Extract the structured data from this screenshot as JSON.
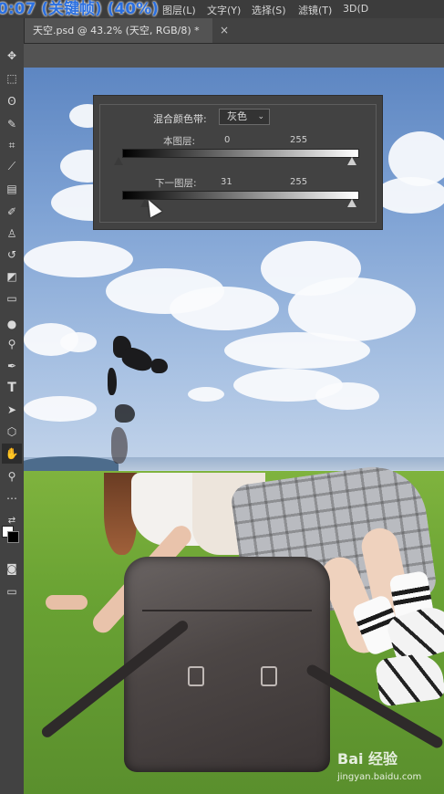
{
  "overlay_status": "0:07 (关键帧) (40%)",
  "menu": {
    "items": [
      "图层(L)",
      "文字(Y)",
      "选择(S)",
      "滤镜(T)",
      "3D(D"
    ]
  },
  "document_tab": {
    "title": "天空.psd @ 43.2% (天空, RGB/8) *",
    "close_glyph": "×"
  },
  "toolbar": {
    "tools": [
      "move-tool",
      "marquee-tool",
      "lasso-tool",
      "quick-select-tool",
      "crop-tool",
      "eyedropper-tool",
      "healing-brush-tool",
      "brush-tool",
      "clone-stamp-tool",
      "history-brush-tool",
      "eraser-tool",
      "gradient-tool",
      "blur-tool",
      "dodge-tool",
      "pen-tool",
      "type-tool",
      "path-select-tool",
      "shape-tool",
      "hand-tool",
      "zoom-tool",
      "more-tools",
      "swap-colors",
      "default-colors",
      "quick-mask",
      "screen-mode"
    ],
    "active_tool": "hand-tool"
  },
  "blend_if": {
    "label": "混合颜色带:",
    "channel": "灰色",
    "this_layer": {
      "label": "本图层:",
      "black": "0",
      "white": "255"
    },
    "underlying_layer": {
      "label": "下一图层:",
      "black": "31",
      "white": "255"
    }
  },
  "watermark": {
    "brand": "Bai 经验",
    "url": "jingyan.baidu.com"
  },
  "colors": {
    "accent": "#2a6fe0",
    "panel_bg": "#424242",
    "workspace_bg": "#535353"
  }
}
